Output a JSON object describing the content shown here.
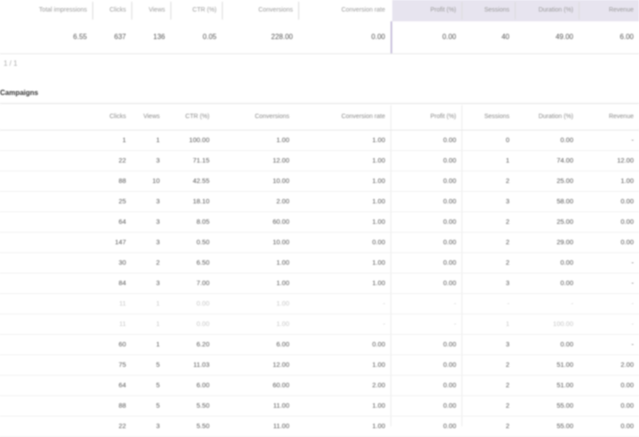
{
  "summary": {
    "headers": [
      "Total impressions",
      "Clicks",
      "Views",
      "CTR (%)",
      "Conversions",
      "Conversion rate",
      "Profit (%)",
      "Sessions",
      "Duration (%)",
      "Revenue"
    ],
    "values": [
      "6.55",
      "637",
      "136",
      "0.05",
      "228.00",
      "0.00",
      "0.00",
      "40",
      "49.00",
      "6.00"
    ]
  },
  "toolbar": {
    "label": "1 / 1"
  },
  "section": {
    "title": "Campaigns"
  },
  "table": {
    "headers": [
      "Clicks",
      "Views",
      "CTR (%)",
      "Conversions",
      "Conversion rate",
      "Profit (%)",
      "Sessions",
      "Duration (%)",
      "Revenue"
    ],
    "rows": [
      {
        "cells": [
          "1",
          "1",
          "100.00",
          "1.00",
          "1.00",
          "0.00",
          "0",
          "0.00",
          "-"
        ],
        "dim": false
      },
      {
        "cells": [
          "22",
          "3",
          "71.15",
          "12.00",
          "1.00",
          "0.00",
          "1",
          "74.00",
          "12.00"
        ],
        "dim": false
      },
      {
        "cells": [
          "88",
          "10",
          "42.55",
          "10.00",
          "1.00",
          "0.00",
          "2",
          "25.00",
          "1.00"
        ],
        "dim": false
      },
      {
        "cells": [
          "25",
          "3",
          "18.10",
          "2.00",
          "1.00",
          "0.00",
          "3",
          "58.00",
          "0.00"
        ],
        "dim": false
      },
      {
        "cells": [
          "64",
          "3",
          "8.05",
          "60.00",
          "1.00",
          "0.00",
          "2",
          "25.00",
          "0.00"
        ],
        "dim": false
      },
      {
        "cells": [
          "147",
          "3",
          "0.50",
          "10.00",
          "0.00",
          "0.00",
          "2",
          "29.00",
          "0.00"
        ],
        "dim": false
      },
      {
        "cells": [
          "30",
          "2",
          "6.50",
          "1.00",
          "1.00",
          "0.00",
          "2",
          "0.00",
          "-"
        ],
        "dim": false
      },
      {
        "cells": [
          "84",
          "3",
          "7.00",
          "1.00",
          "1.00",
          "0.00",
          "3",
          "0.00",
          "-"
        ],
        "dim": false
      },
      {
        "cells": [
          "11",
          "1",
          "0.00",
          "1.00",
          "-",
          "-",
          "-",
          "-",
          "-"
        ],
        "dim": true
      },
      {
        "cells": [
          "11",
          "1",
          "0.00",
          "1.00",
          "-",
          "-",
          "1",
          "100.00",
          "-"
        ],
        "dim": true
      },
      {
        "cells": [
          "60",
          "1",
          "6.20",
          "6.00",
          "0.00",
          "0.00",
          "3",
          "0.00",
          "-"
        ],
        "dim": false
      },
      {
        "cells": [
          "75",
          "5",
          "11.03",
          "12.00",
          "1.00",
          "0.00",
          "2",
          "51.00",
          "2.00"
        ],
        "dim": false
      },
      {
        "cells": [
          "64",
          "5",
          "6.00",
          "60.00",
          "2.00",
          "0.00",
          "2",
          "51.00",
          "0.00"
        ],
        "dim": false
      },
      {
        "cells": [
          "88",
          "5",
          "5.50",
          "11.00",
          "1.00",
          "0.00",
          "2",
          "55.00",
          "0.00"
        ],
        "dim": false
      },
      {
        "cells": [
          "22",
          "3",
          "5.50",
          "11.00",
          "1.00",
          "0.00",
          "2",
          "55.00",
          "0.00"
        ],
        "dim": false
      }
    ]
  },
  "colors": {
    "accent_band": "#e7e4ef",
    "accent_line": "#c9c2dc"
  }
}
